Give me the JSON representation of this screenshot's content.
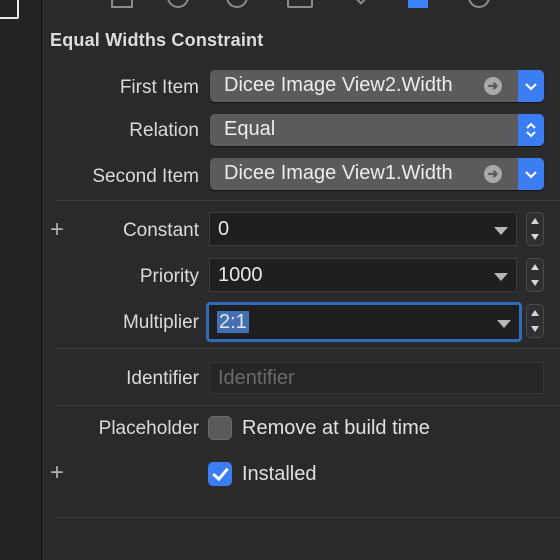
{
  "inspector": {
    "title": "Equal Widths Constraint",
    "first_item": {
      "label": "First Item",
      "value": "Dicee Image View2.Width"
    },
    "relation": {
      "label": "Relation",
      "value": "Equal"
    },
    "second_item": {
      "label": "Second Item",
      "value": "Dicee Image View1.Width"
    },
    "constant": {
      "label": "Constant",
      "value": "0"
    },
    "priority": {
      "label": "Priority",
      "value": "1000"
    },
    "multiplier": {
      "label": "Multiplier",
      "value": "2:1"
    },
    "identifier": {
      "label": "Identifier",
      "value": "",
      "placeholder": "Identifier"
    },
    "placeholder": {
      "label": "Placeholder",
      "option": "Remove at build time",
      "checked": false
    },
    "installed": {
      "label": "Installed",
      "checked": true
    },
    "add_symbol": "+"
  },
  "colors": {
    "accent": "#3b7ef3",
    "background": "#2a2a2c",
    "focus_ring": "#2f6bb7"
  },
  "icons": [
    "file-icon",
    "help-circle-icon",
    "identity-circle-icon",
    "attributes-icon",
    "ruler-icon",
    "size-inspector-icon",
    "connections-icon"
  ]
}
